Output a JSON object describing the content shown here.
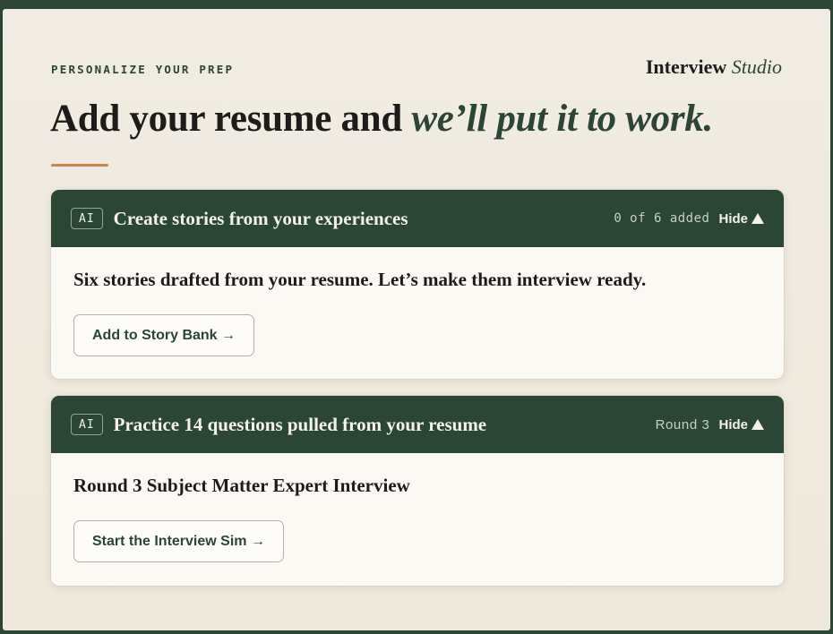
{
  "header": {
    "eyebrow": "PERSONALIZE YOUR PREP",
    "brand_main": "Interview",
    "brand_italic": "Studio",
    "headline_main": "Add your resume and ",
    "headline_accent": "we’ll put it to work."
  },
  "cards": [
    {
      "badge": "AI",
      "title": "Create stories from your experiences",
      "status": "0 of 6 added",
      "toggle_label": "Hide",
      "body_text": "Six stories drafted from your resume. Let’s make them interview ready.",
      "button_label": "Add to Story Bank →"
    },
    {
      "badge": "AI",
      "title": "Practice 14 questions pulled from your resume",
      "status": "Round 3",
      "toggle_label": "Hide",
      "body_text": "Round 3 Subject Matter Expert Interview",
      "button_label": "Start the Interview Sim →"
    }
  ],
  "colors": {
    "primary_green": "#2b4635",
    "accent_rule": "#c9874a",
    "background": "#f1ece3",
    "card_background": "#fbf9f4"
  },
  "icons": {
    "toggle": "triangle-up-icon"
  }
}
